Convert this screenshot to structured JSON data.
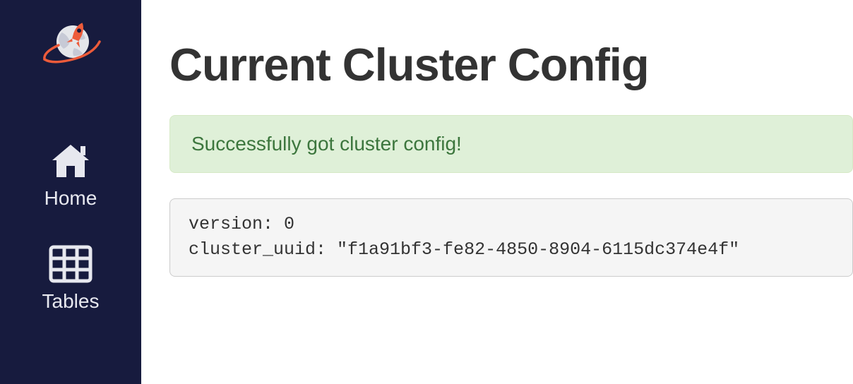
{
  "sidebar": {
    "items": [
      {
        "label": "Home"
      },
      {
        "label": "Tables"
      }
    ]
  },
  "main": {
    "title": "Current Cluster Config",
    "alert_message": "Successfully got cluster config!",
    "config_text": "version: 0\ncluster_uuid: \"f1a91bf3-fe82-4850-8904-6115dc374e4f\""
  }
}
